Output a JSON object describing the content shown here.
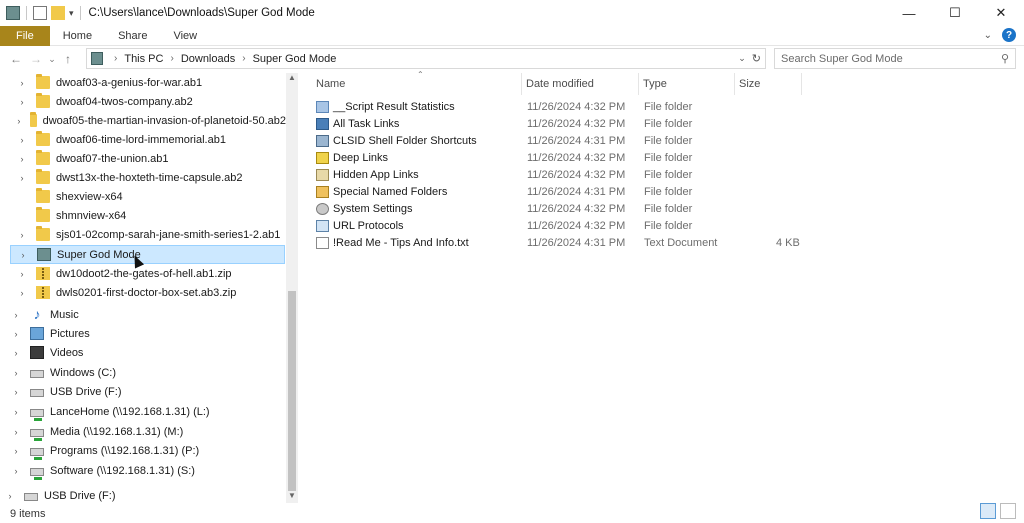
{
  "window": {
    "title": "C:\\Users\\lance\\Downloads\\Super God Mode"
  },
  "ribbon": {
    "tabs": [
      "File",
      "Home",
      "Share",
      "View"
    ]
  },
  "address": {
    "crumbs": [
      "This PC",
      "Downloads",
      "Super God Mode"
    ]
  },
  "search": {
    "placeholder": "Search Super God Mode"
  },
  "nav_tree": [
    {
      "label": "dwoaf03-a-genius-for-war.ab1",
      "icon": "folder-icon",
      "expand": true
    },
    {
      "label": "dwoaf04-twos-company.ab2",
      "icon": "folder-icon",
      "expand": true
    },
    {
      "label": "dwoaf05-the-martian-invasion-of-planetoid-50.ab2",
      "icon": "folder-icon",
      "expand": true
    },
    {
      "label": "dwoaf06-time-lord-immemorial.ab1",
      "icon": "folder-icon",
      "expand": true
    },
    {
      "label": "dwoaf07-the-union.ab1",
      "icon": "folder-icon",
      "expand": true
    },
    {
      "label": "dwst13x-the-hoxteth-time-capsule.ab2",
      "icon": "folder-icon",
      "expand": true
    },
    {
      "label": "shexview-x64",
      "icon": "folder-icon",
      "expand": false
    },
    {
      "label": "shmnview-x64",
      "icon": "folder-icon",
      "expand": false
    },
    {
      "label": "sjs01-02comp-sarah-jane-smith-series1-2.ab1",
      "icon": "folder-icon",
      "expand": true
    },
    {
      "label": "Super God Mode",
      "icon": "god-mode-icon",
      "expand": true,
      "selected": true
    },
    {
      "label": "dw10doot2-the-gates-of-hell.ab1.zip",
      "icon": "zip-folder-icon",
      "expand": true
    },
    {
      "label": "dwls0201-first-doctor-box-set.ab3.zip",
      "icon": "zip-folder-icon",
      "expand": true
    },
    {
      "label": "Music",
      "icon": "music-icon",
      "expand": true,
      "level": 1
    },
    {
      "label": "Pictures",
      "icon": "pictures-icon",
      "expand": true,
      "level": 1
    },
    {
      "label": "Videos",
      "icon": "videos-icon",
      "expand": true,
      "level": 1
    },
    {
      "label": "Windows (C:)",
      "icon": "windows-drive-icon",
      "expand": true,
      "level": 1
    },
    {
      "label": "USB Drive (F:)",
      "icon": "usb-drive-icon",
      "expand": true,
      "level": 1
    },
    {
      "label": "LanceHome (\\\\192.168.1.31) (L:)",
      "icon": "network-drive-icon",
      "expand": true,
      "level": 1
    },
    {
      "label": "Media (\\\\192.168.1.31) (M:)",
      "icon": "network-drive-icon",
      "expand": true,
      "level": 1
    },
    {
      "label": "Programs (\\\\192.168.1.31) (P:)",
      "icon": "network-drive-icon",
      "expand": true,
      "level": 1
    },
    {
      "label": "Software (\\\\192.168.1.31) (S:)",
      "icon": "network-drive-icon",
      "expand": true,
      "level": 1
    },
    {
      "label": "USB Drive (F:)",
      "icon": "usb-drive-icon",
      "expand": true,
      "level": 0
    }
  ],
  "columns": [
    "Name",
    "Date modified",
    "Type",
    "Size"
  ],
  "files": [
    {
      "name": "__Script Result Statistics",
      "date": "11/26/2024 4:32 PM",
      "type": "File folder",
      "size": "",
      "icon": "script-folder-icon"
    },
    {
      "name": "All Task Links",
      "date": "11/26/2024 4:32 PM",
      "type": "File folder",
      "size": "",
      "icon": "control-panel-icon"
    },
    {
      "name": "CLSID Shell Folder Shortcuts",
      "date": "11/26/2024 4:31 PM",
      "type": "File folder",
      "size": "",
      "icon": "clsid-folder-icon"
    },
    {
      "name": "Deep Links",
      "date": "11/26/2024 4:32 PM",
      "type": "File folder",
      "size": "",
      "icon": "deep-links-icon"
    },
    {
      "name": "Hidden App Links",
      "date": "11/26/2024 4:32 PM",
      "type": "File folder",
      "size": "",
      "icon": "hidden-app-links-icon"
    },
    {
      "name": "Special Named Folders",
      "date": "11/26/2024 4:31 PM",
      "type": "File folder",
      "size": "",
      "icon": "special-folders-icon"
    },
    {
      "name": "System Settings",
      "date": "11/26/2024 4:32 PM",
      "type": "File folder",
      "size": "",
      "icon": "gear-icon"
    },
    {
      "name": "URL Protocols",
      "date": "11/26/2024 4:32 PM",
      "type": "File folder",
      "size": "",
      "icon": "url-protocols-icon"
    },
    {
      "name": "!Read Me - Tips And Info.txt",
      "date": "11/26/2024 4:31 PM",
      "type": "Text Document",
      "size": "4 KB",
      "icon": "text-document-icon"
    }
  ],
  "status": {
    "item_count": "9 items"
  },
  "colors": {
    "file_tab": "#a8851b",
    "selection_bg": "#cce8ff",
    "selection_border": "#99d1ff",
    "folder": "#f1c94a"
  }
}
